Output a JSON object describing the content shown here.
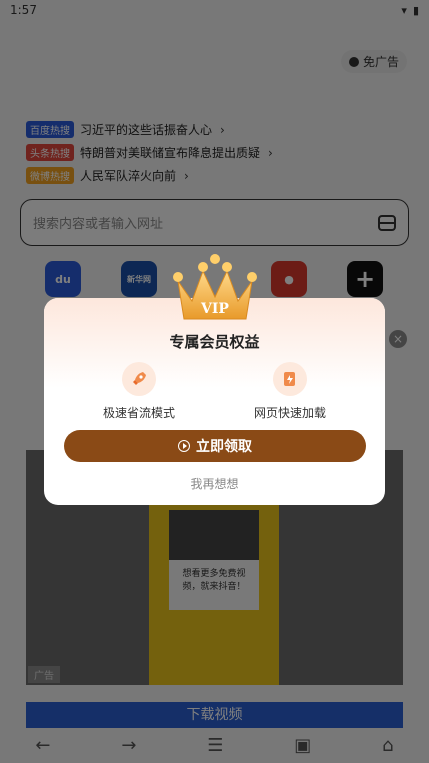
{
  "status": {
    "time": "1:57"
  },
  "header": {
    "no_ad_label": "免广告"
  },
  "hot": [
    {
      "tag": "百度热搜",
      "color": "blue",
      "text": "习近平的这些话振奋人心"
    },
    {
      "tag": "头条热搜",
      "color": "red",
      "text": "特朗普对美联储宣布降息提出质疑"
    },
    {
      "tag": "微博热搜",
      "color": "orange",
      "text": "人民军队淬火向前"
    }
  ],
  "search": {
    "placeholder": "搜索内容或者输入网址"
  },
  "apps": {
    "xinhua": "新华网",
    "baidu": "du"
  },
  "ad": {
    "label": "广告",
    "card_text": "想看更多免费视频，就来抖音！",
    "download": "下载视频"
  },
  "modal": {
    "crown_text": "VIP",
    "title": "专属会员权益",
    "features": [
      {
        "label": "极速省流模式",
        "icon": "rocket-icon"
      },
      {
        "label": "网页快速加载",
        "icon": "fast-page-icon"
      }
    ],
    "claim_label": "立即领取",
    "later_label": "我再想想"
  },
  "colors": {
    "accent": "#8a4a16",
    "modal_bg": "#ffffff"
  }
}
